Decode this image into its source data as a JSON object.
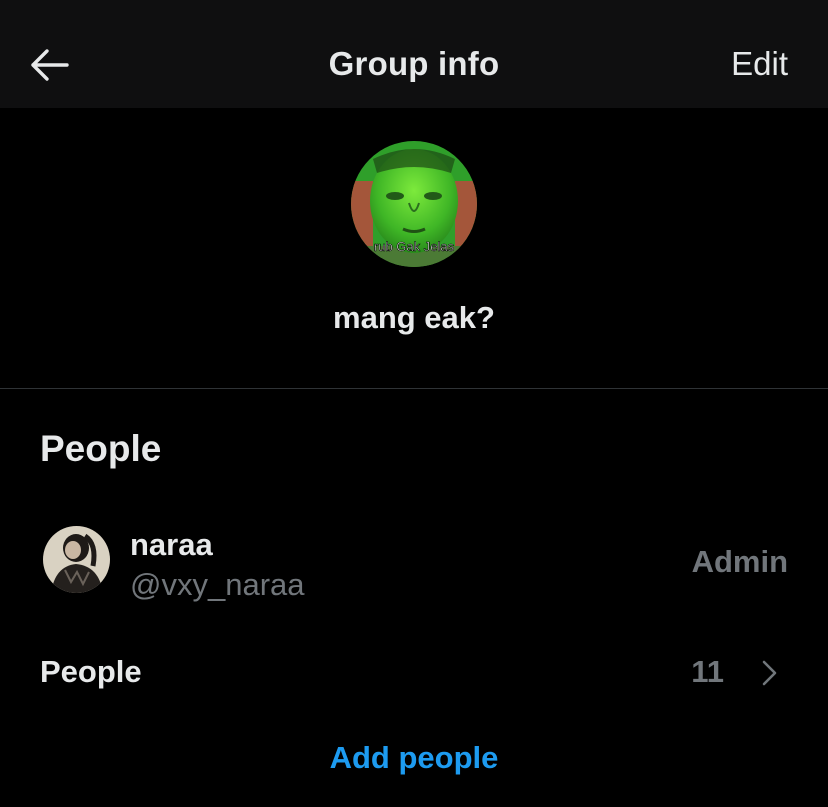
{
  "header": {
    "title": "Group info",
    "edit_label": "Edit",
    "back_icon": "arrow-left-icon"
  },
  "group": {
    "name": "mang eak?",
    "avatar_caption": "rub Gak Jelas"
  },
  "people_section": {
    "title": "People",
    "members": [
      {
        "name": "naraa",
        "handle": "@vxy_naraa",
        "role": "Admin"
      }
    ],
    "people_row_label": "People",
    "people_count": "11",
    "chevron_icon": "chevron-right-icon",
    "add_people_label": "Add people"
  },
  "colors": {
    "background": "#000000",
    "header_bg": "#0f0f10",
    "primary_text": "#e7e9ea",
    "secondary_text": "#71767b",
    "accent": "#1d9bf0",
    "divider": "#2f3336"
  }
}
